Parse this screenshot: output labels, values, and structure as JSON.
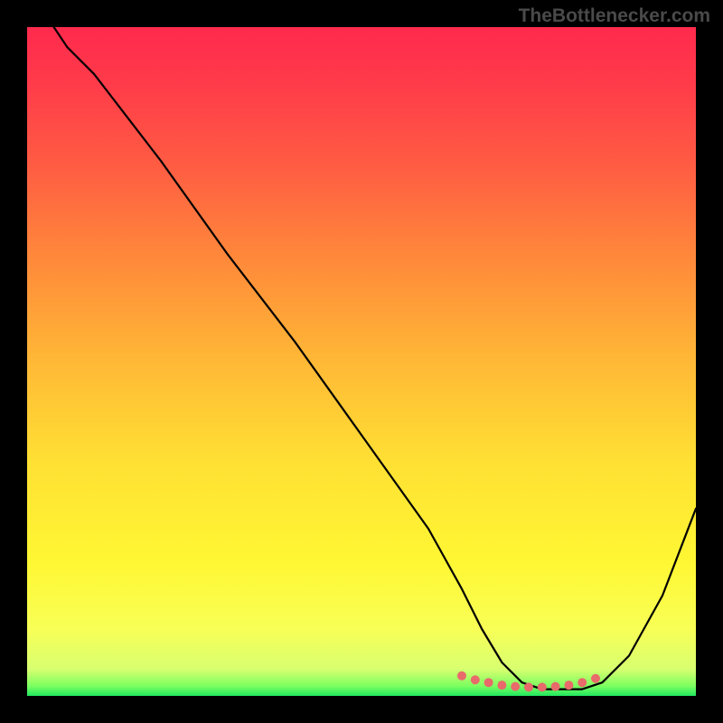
{
  "watermark": "TheBottlenecker.com",
  "chart_data": {
    "type": "line",
    "title": "",
    "xlabel": "",
    "ylabel": "",
    "xlim": [
      0,
      100
    ],
    "ylim": [
      0,
      100
    ],
    "series": [
      {
        "name": "curve",
        "color": "#000000",
        "x": [
          4,
          6,
          10,
          20,
          30,
          40,
          50,
          60,
          65,
          68,
          71,
          74,
          77,
          80,
          83,
          86,
          90,
          95,
          100
        ],
        "values": [
          100,
          97,
          93,
          80,
          66,
          53,
          39,
          25,
          16,
          10,
          5,
          2,
          1,
          1,
          1,
          2,
          6,
          15,
          28
        ]
      }
    ],
    "dotted_segment": {
      "color": "#e86a6a",
      "x": [
        65,
        67,
        69,
        71,
        73,
        75,
        77,
        79,
        81,
        83,
        85
      ],
      "y": [
        3.0,
        2.4,
        2.0,
        1.6,
        1.4,
        1.3,
        1.3,
        1.4,
        1.6,
        2.0,
        2.6
      ]
    },
    "gradient_stops": [
      {
        "offset": 0.0,
        "color": "#ff2a4d"
      },
      {
        "offset": 0.08,
        "color": "#ff3a4a"
      },
      {
        "offset": 0.2,
        "color": "#ff5a43"
      },
      {
        "offset": 0.35,
        "color": "#ff8a3a"
      },
      {
        "offset": 0.5,
        "color": "#ffb836"
      },
      {
        "offset": 0.65,
        "color": "#ffe033"
      },
      {
        "offset": 0.8,
        "color": "#fff733"
      },
      {
        "offset": 0.9,
        "color": "#f8ff56"
      },
      {
        "offset": 0.96,
        "color": "#d8ff70"
      },
      {
        "offset": 0.985,
        "color": "#7dff60"
      },
      {
        "offset": 1.0,
        "color": "#20e860"
      }
    ]
  }
}
